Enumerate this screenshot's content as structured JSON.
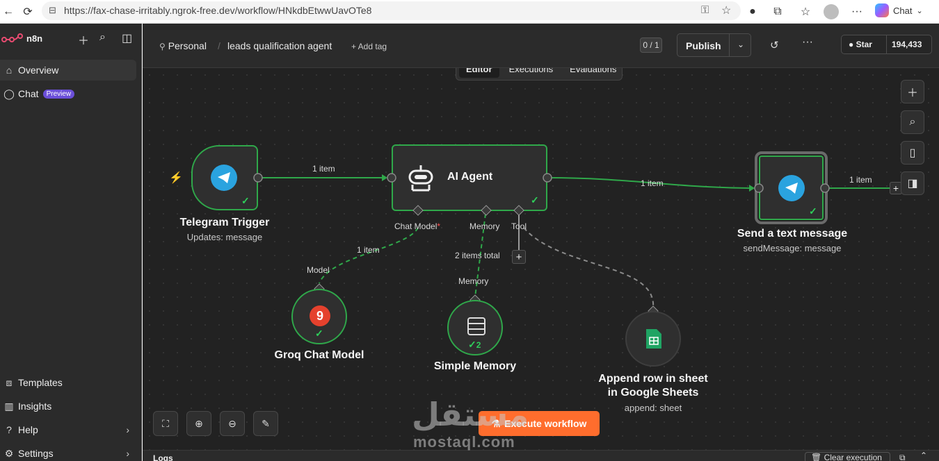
{
  "browser": {
    "url": "https://fax-chase-irritably.ngrok-free.dev/workflow/HNkdbEtwwUavOTe8",
    "chat_label": "Chat"
  },
  "sidebar": {
    "brand": "n8n",
    "items_top": [
      {
        "label": "Overview",
        "icon": "home-icon"
      },
      {
        "label": "Chat",
        "icon": "chat-bubble-icon",
        "badge": "Preview"
      }
    ],
    "items_bottom": [
      {
        "label": "Templates",
        "icon": "templates-icon"
      },
      {
        "label": "Insights",
        "icon": "insights-icon"
      },
      {
        "label": "Help",
        "icon": "help-icon"
      },
      {
        "label": "Settings",
        "icon": "settings-icon"
      }
    ]
  },
  "header": {
    "project": "Personal",
    "workflow_name": "leads qualification agent",
    "add_tag": "+ Add tag",
    "counter": "0 / 1",
    "publish_label": "Publish",
    "github_star": "Star",
    "github_count": "194,433"
  },
  "tabs": [
    "Editor",
    "Executions",
    "Evaluations"
  ],
  "active_tab": "Editor",
  "nodes": {
    "telegram_trigger": {
      "label": "Telegram Trigger",
      "sub": "Updates: message"
    },
    "ai_agent": {
      "label": "AI Agent",
      "ports": [
        "Chat Model",
        "Memory",
        "Tool"
      ],
      "required_mark": "*"
    },
    "send_message": {
      "label": "Send a text message",
      "sub": "sendMessage: message"
    },
    "groq": {
      "label": "Groq Chat Model",
      "port": "Model"
    },
    "memory": {
      "label": "Simple Memory",
      "port": "Memory",
      "count": "2"
    },
    "sheets": {
      "label_line1": "Append row in sheet",
      "label_line2": "in Google Sheets",
      "sub": "append: sheet"
    }
  },
  "edges": {
    "trigger_to_agent": "1 item",
    "agent_to_send": "1 item",
    "send_out": "1 item",
    "model_to_agent": "1 item",
    "memory_to_agent": "2 items total"
  },
  "execute_label": "Execute workflow",
  "logs": {
    "label": "Logs",
    "clear": "Clear execution"
  },
  "watermark": {
    "arabic": "مستقل",
    "latin": "mostaql.com"
  },
  "colors": {
    "accent": "#ff6d2d",
    "success": "#2fa84a",
    "telegram": "#2aa3df",
    "groq": "#e5412d",
    "sheets": "#1fa463"
  }
}
